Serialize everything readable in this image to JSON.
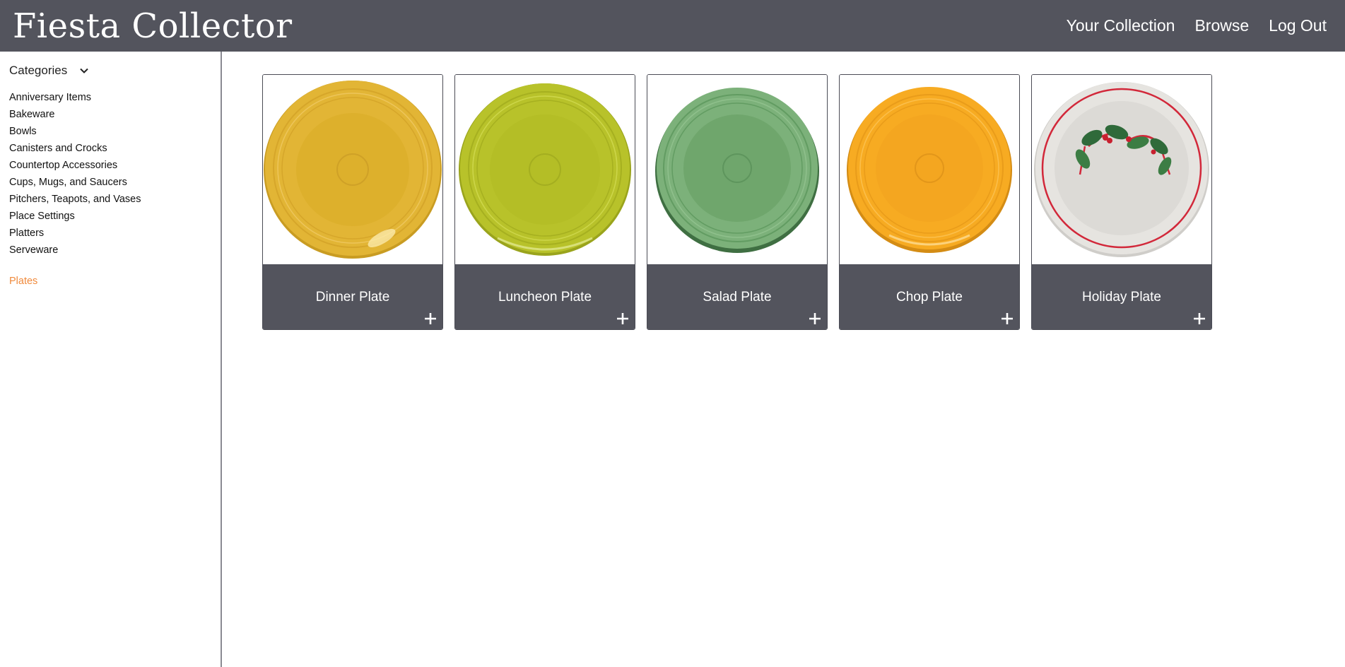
{
  "header": {
    "brand": "Fiesta Collector",
    "nav": [
      "Your Collection",
      "Browse",
      "Log Out"
    ]
  },
  "sidebar": {
    "categories_label": "Categories",
    "categories": [
      "Anniversary Items",
      "Bakeware",
      "Bowls",
      "Canisters and Crocks",
      "Countertop Accessories",
      "Cups, Mugs, and Saucers",
      "Pitchers, Teapots, and Vases",
      "Place Settings",
      "Platters",
      "Serveware"
    ],
    "active_category": "Plates"
  },
  "products": [
    {
      "name": "Dinner Plate",
      "color": "#e2b535"
    },
    {
      "name": "Luncheon Plate",
      "color": "#b8c22a"
    },
    {
      "name": "Salad Plate",
      "color": "#6fa66c"
    },
    {
      "name": "Chop Plate",
      "color": "#f7ab22"
    },
    {
      "name": "Holiday Plate",
      "color": "#e6e4e0"
    }
  ],
  "colors": {
    "header_bg": "#53545d",
    "accent": "#f08a3c"
  }
}
